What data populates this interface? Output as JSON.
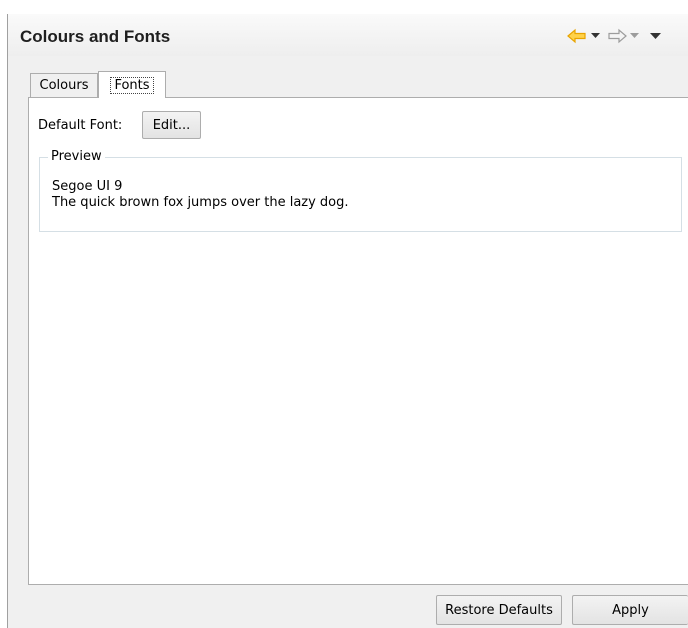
{
  "header": {
    "title": "Colours and Fonts"
  },
  "tabs": [
    {
      "label": "Colours",
      "active": false
    },
    {
      "label": "Fonts",
      "active": true
    }
  ],
  "fonts_page": {
    "default_font_label": "Default Font:",
    "edit_button": "Edit...",
    "preview_group": {
      "legend": "Preview",
      "font_name": "Segoe UI 9",
      "sample_text": "The quick brown fox jumps over the lazy dog."
    }
  },
  "buttons": {
    "restore_defaults": "Restore Defaults",
    "apply": "Apply"
  },
  "colors": {
    "nav_arrow_active": "#e8a400",
    "nav_arrow_inactive": "#9c9c9c"
  }
}
